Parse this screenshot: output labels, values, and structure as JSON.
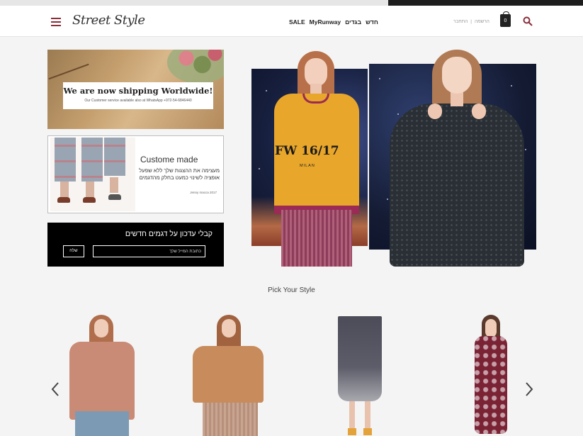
{
  "header": {
    "logo": "Street Style",
    "nav": [
      "SALE",
      "MyRunway",
      "בגדים",
      "חדש"
    ],
    "account": [
      "התחבר",
      "הרשמה"
    ],
    "cart_count": "0"
  },
  "promo_shipping": {
    "title": "We are now shipping Worldwide!",
    "subtitle": "Our Customer service available also at WhatsApp +972-54-6846440"
  },
  "promo_custom": {
    "title": "Custome made",
    "text": "מעצימה את ההצגות שלך ללא שפעל אופציה לשינוי כמעט בחלק מהדגמים",
    "signature": "Jenny macca 2017"
  },
  "newsletter": {
    "title": "קבלי עדכון על דגמים חדשים",
    "input_placeholder": "כתובת המייל שלך",
    "button": "שלח"
  },
  "hero": {
    "title": "FW 16/17",
    "subtitle": "MILAN"
  },
  "section": {
    "title": "Pick Your Style"
  },
  "colors": {
    "accent": "#8a2e3a",
    "cardigan": "#e8a62b",
    "dress": "#2a2f35"
  }
}
